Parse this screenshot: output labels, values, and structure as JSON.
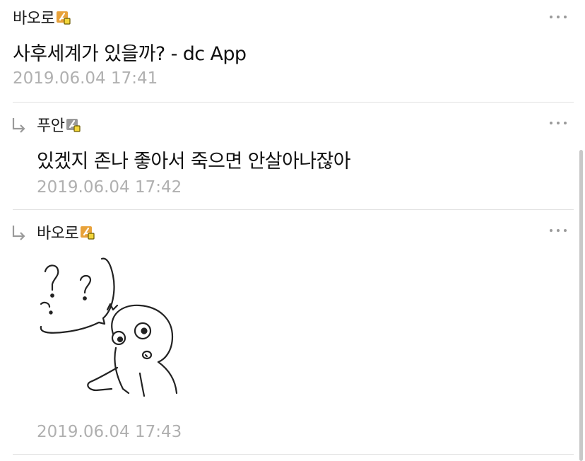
{
  "comments": [
    {
      "author": "바오로",
      "text": "사후세계가 있을까?  - dc App",
      "date": "2019.06.04 17:41",
      "is_reply": false
    },
    {
      "author": "푸안",
      "text": "있겠지 존나 좋아서 죽으면 안살아나잖아",
      "date": "2019.06.04 17:42",
      "is_reply": true
    },
    {
      "author": "바오로",
      "text": "",
      "date": "2019.06.04 17:43",
      "is_reply": true,
      "image": "confused-character-sticker"
    }
  ],
  "icons": {
    "more": "more-options-icon",
    "reply": "reply-arrow-icon",
    "badge": "user-badge-icon"
  },
  "colors": {
    "date_gray": "#b0b0b0",
    "divider": "#e1e1e1",
    "badge_orange": "#e8a23a",
    "badge_yellow": "#f3d63a",
    "badge_gray": "#9a9a9a"
  }
}
